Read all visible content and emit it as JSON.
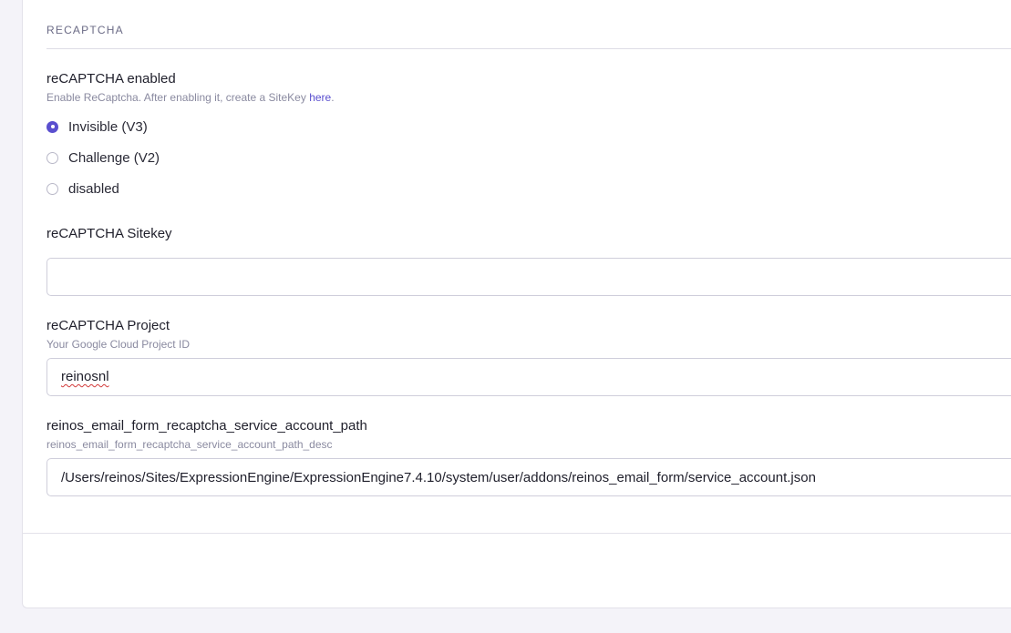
{
  "section": {
    "heading": "RECAPTCHA"
  },
  "recaptcha_enabled": {
    "label": "reCAPTCHA enabled",
    "description_prefix": "Enable ReCaptcha. After enabling it, create a SiteKey ",
    "description_link": "here",
    "description_suffix": ".",
    "options": [
      {
        "label": "Invisible (V3)",
        "checked": true
      },
      {
        "label": "Challenge (V2)",
        "checked": false
      },
      {
        "label": "disabled",
        "checked": false
      }
    ]
  },
  "sitekey": {
    "label": "reCAPTCHA Sitekey",
    "value": ""
  },
  "project": {
    "label": "reCAPTCHA Project",
    "description": "Your Google Cloud Project ID",
    "value": "reinosnl"
  },
  "service_account": {
    "label": "reinos_email_form_recaptcha_service_account_path",
    "description": "reinos_email_form_recaptcha_service_account_path_desc",
    "value": "/Users/reinos/Sites/ExpressionEngine/ExpressionEngine7.4.10/system/user/addons/reinos_email_form/service_account.json"
  },
  "colors": {
    "accent": "#5a4fcf",
    "page_background": "#f4f3f9",
    "panel_background": "#ffffff"
  }
}
